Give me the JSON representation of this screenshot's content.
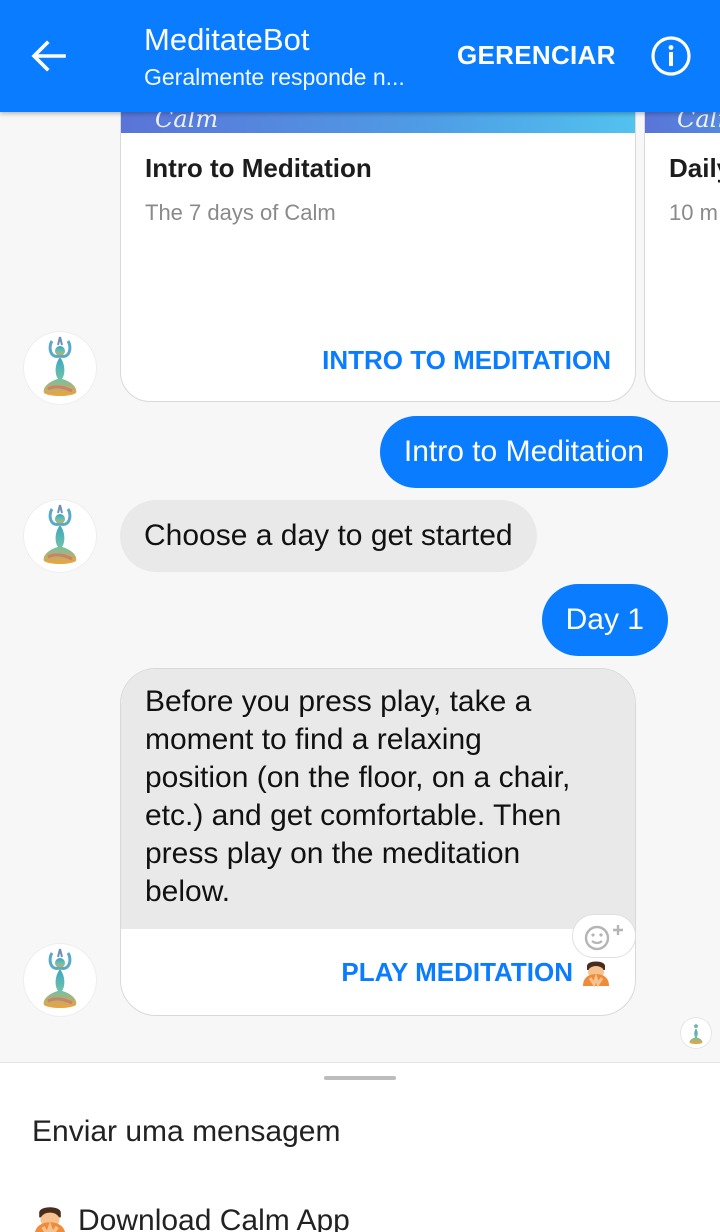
{
  "header": {
    "title": "MeditateBot",
    "subtitle": "Geralmente responde n...",
    "manage_label": "GERENCIAR"
  },
  "cards": [
    {
      "logo": "Calm",
      "title": "Intro to Meditation",
      "subtitle": "The 7 days of Calm",
      "button": "INTRO TO MEDITATION"
    },
    {
      "logo": "Calm",
      "title": "Daily",
      "subtitle": "10 m"
    }
  ],
  "messages": [
    {
      "from": "user",
      "text": "Intro to Meditation"
    },
    {
      "from": "bot",
      "text": "Choose a day to get started"
    },
    {
      "from": "user",
      "text": "Day 1"
    },
    {
      "from": "bot",
      "lines": [
        "Before you press play, take a",
        "moment to find a relaxing",
        "position (on the floor, on a chair,",
        "etc.) and get comfortable. Then",
        "press play on the meditation",
        "below."
      ],
      "button": "PLAY MEDITATION"
    }
  ],
  "composer": {
    "placeholder": "Enviar uma mensagem",
    "quick_reply": "Download Calm App"
  },
  "colors": {
    "accent": "#0a7cff",
    "bubble_in": "#e9e9e9",
    "background": "#f7f7f7"
  },
  "icons": {
    "back": "arrow-left-icon",
    "info": "info-circle-icon",
    "avatar": "meditating-figure-icon",
    "react": "add-reaction-icon",
    "emoji": "person-bowing-emoji"
  }
}
